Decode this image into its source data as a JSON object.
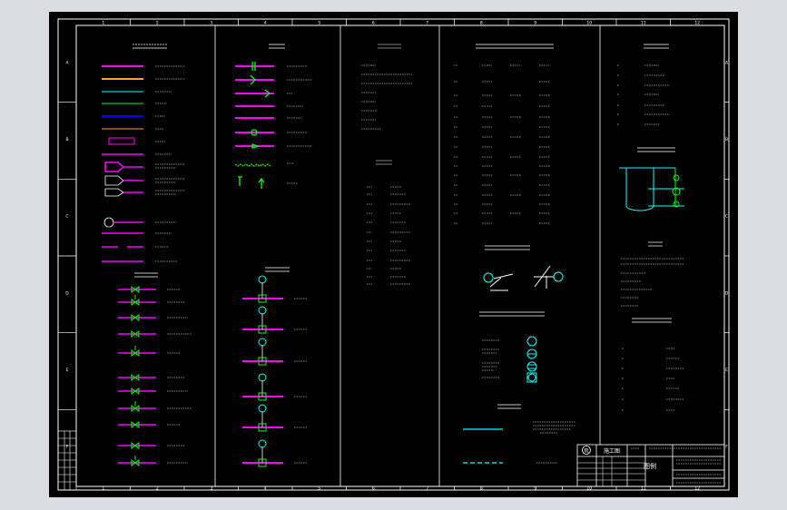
{
  "colors": {
    "background": "#000000",
    "frame": "#ffffff",
    "magenta": "#ff00ff",
    "green": "#00ff00",
    "cyan": "#00ffff",
    "blue": "#0000ff",
    "orange": "#ffa040",
    "yellow": "#ffff00"
  },
  "border": {
    "top_numbers": [
      "1",
      "2",
      "3",
      "4",
      "5",
      "6",
      "7",
      "8",
      "9",
      "10",
      "11",
      "12"
    ],
    "side_letters": [
      "A",
      "B",
      "C",
      "D",
      "E",
      "F"
    ]
  },
  "title_block": {
    "logo_text": "院",
    "project_id": "施工图",
    "drawing_title": "图例"
  }
}
